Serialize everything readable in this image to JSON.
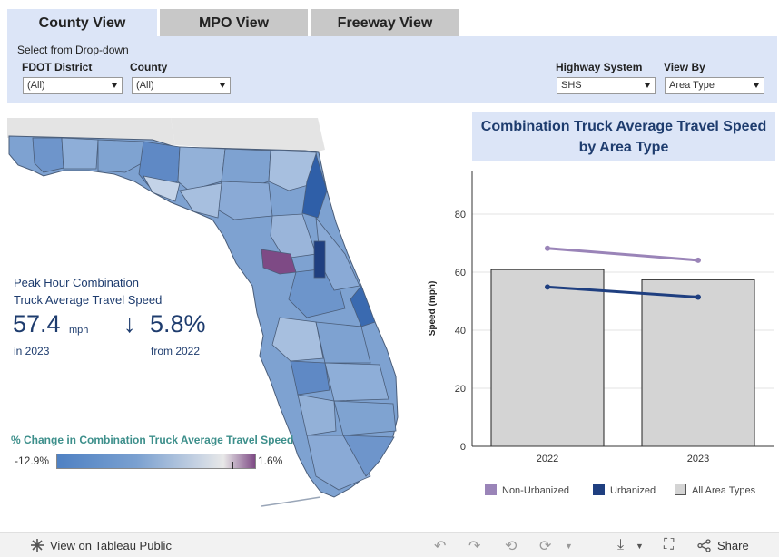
{
  "tabs": [
    {
      "label": "County View",
      "active": true
    },
    {
      "label": "MPO View",
      "active": false
    },
    {
      "label": "Freeway View",
      "active": false
    }
  ],
  "filters": {
    "title": "Select from Drop-down",
    "district": {
      "label": "FDOT District",
      "value": "(All)"
    },
    "county": {
      "label": "County",
      "value": "(All)"
    },
    "highway": {
      "label": "Highway System",
      "value": "SHS"
    },
    "viewby": {
      "label": "View By",
      "value": "Area Type"
    }
  },
  "kpi": {
    "label_line1": "Peak Hour Combination",
    "label_line2": "Truck Average Travel Speed",
    "value": "57.4",
    "unit": "mph",
    "year_text": "in 2023",
    "change_arrow": "↓",
    "change_value": "5.8%",
    "change_text": "from 2022"
  },
  "map_legend": {
    "title": "% Change in Combination Truck Average Travel Speed",
    "min": "-12.9%",
    "max": "1.6%"
  },
  "colors": {
    "accent_navy": "#1e3c6e",
    "panel_blue": "#dce5f7",
    "non_urbanized": "#9a84b8",
    "urbanized": "#1f3f80",
    "all_area_types": "#d4d4d4"
  },
  "chart_data": {
    "type": "bar",
    "title": "Combination Truck Average Travel Speed by Area Type",
    "ylabel": "Speed (mph)",
    "ylim": [
      0,
      95
    ],
    "yticks": [
      "0",
      "20",
      "40",
      "60",
      "80"
    ],
    "categories": [
      "2022",
      "2023"
    ],
    "series": [
      {
        "name": "All Area Types",
        "kind": "bar",
        "values": [
          60.9,
          57.4
        ]
      },
      {
        "name": "Non-Urbanized",
        "kind": "line",
        "values": [
          68.2,
          64.1
        ]
      },
      {
        "name": "Urbanized",
        "kind": "line",
        "values": [
          54.9,
          51.4
        ]
      }
    ],
    "legend": {
      "placement": "bottom",
      "items": [
        "Non-Urbanized",
        "Urbanized",
        "All Area Types"
      ]
    }
  },
  "footer": {
    "view_on": "View on Tableau Public",
    "share": "Share"
  }
}
